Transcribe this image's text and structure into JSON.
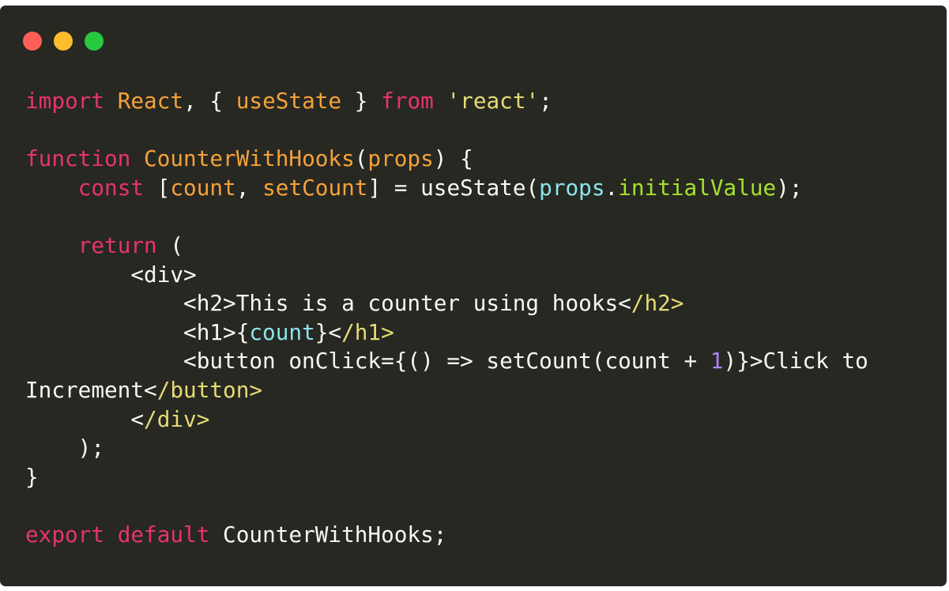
{
  "window": {
    "controls": [
      {
        "name": "close",
        "color": "#ff5f56"
      },
      {
        "name": "minimize",
        "color": "#ffbd2e"
      },
      {
        "name": "maximize",
        "color": "#27c93f"
      }
    ]
  },
  "theme": {
    "background": "#272822",
    "keyword": "#e8336f",
    "identifier": "#f5a23a",
    "string": "#e6db74",
    "property": "#8be4ec",
    "method": "#a6e22e",
    "number": "#ae81ff",
    "plain": "#f8f8f2"
  },
  "code": {
    "language": "javascript",
    "lines": [
      [
        {
          "t": "kw",
          "v": "import"
        },
        {
          "t": "pl",
          "v": " "
        },
        {
          "t": "fn",
          "v": "React"
        },
        {
          "t": "pl",
          "v": ", { "
        },
        {
          "t": "fn",
          "v": "useState"
        },
        {
          "t": "pl",
          "v": " } "
        },
        {
          "t": "kw",
          "v": "from"
        },
        {
          "t": "pl",
          "v": " "
        },
        {
          "t": "str",
          "v": "'react'"
        },
        {
          "t": "pl",
          "v": ";"
        }
      ],
      [],
      [
        {
          "t": "kw",
          "v": "function"
        },
        {
          "t": "pl",
          "v": " "
        },
        {
          "t": "fn",
          "v": "CounterWithHooks"
        },
        {
          "t": "pl",
          "v": "("
        },
        {
          "t": "fn",
          "v": "props"
        },
        {
          "t": "pl",
          "v": ") {"
        }
      ],
      [
        {
          "t": "pl",
          "v": "    "
        },
        {
          "t": "kw",
          "v": "const"
        },
        {
          "t": "pl",
          "v": " ["
        },
        {
          "t": "fn",
          "v": "count"
        },
        {
          "t": "pl",
          "v": ", "
        },
        {
          "t": "fn",
          "v": "setCount"
        },
        {
          "t": "pl",
          "v": "] = useState("
        },
        {
          "t": "cy",
          "v": "props"
        },
        {
          "t": "pl",
          "v": "."
        },
        {
          "t": "gr",
          "v": "initialValue"
        },
        {
          "t": "pl",
          "v": ");"
        }
      ],
      [],
      [
        {
          "t": "pl",
          "v": "    "
        },
        {
          "t": "kw",
          "v": "return"
        },
        {
          "t": "pl",
          "v": " ("
        }
      ],
      [
        {
          "t": "pl",
          "v": "        <div>"
        }
      ],
      [
        {
          "t": "pl",
          "v": "            <h2>This is a counter using hooks<"
        },
        {
          "t": "tag",
          "v": "/h2>"
        }
      ],
      [
        {
          "t": "pl",
          "v": "            <h1>{"
        },
        {
          "t": "cy",
          "v": "count"
        },
        {
          "t": "pl",
          "v": "}<"
        },
        {
          "t": "tag",
          "v": "/h1>"
        }
      ],
      [
        {
          "t": "pl",
          "v": "            <button onClick={() => setCount(count + "
        },
        {
          "t": "num",
          "v": "1"
        },
        {
          "t": "pl",
          "v": ")}>Click to"
        }
      ],
      [
        {
          "t": "pl",
          "v": "Increment<"
        },
        {
          "t": "tag",
          "v": "/button>"
        }
      ],
      [
        {
          "t": "pl",
          "v": "        <"
        },
        {
          "t": "tag",
          "v": "/div>"
        }
      ],
      [
        {
          "t": "pl",
          "v": "    );"
        }
      ],
      [
        {
          "t": "pl",
          "v": "}"
        }
      ],
      [],
      [
        {
          "t": "kw",
          "v": "export"
        },
        {
          "t": "pl",
          "v": " "
        },
        {
          "t": "kw",
          "v": "default"
        },
        {
          "t": "pl",
          "v": " CounterWithHooks;"
        }
      ]
    ]
  }
}
